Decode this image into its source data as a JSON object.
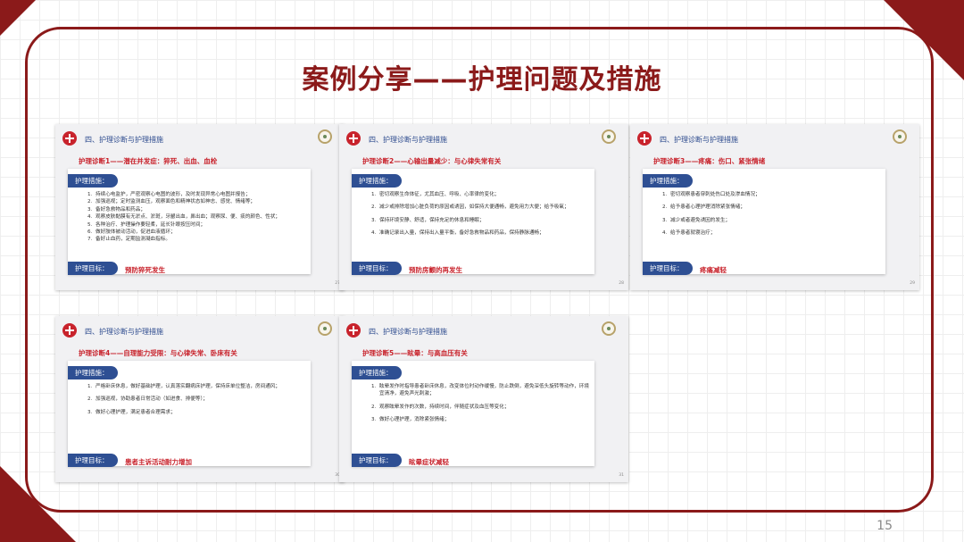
{
  "title": "案例分享——护理问题及措施",
  "page_number": "15",
  "slides": [
    {
      "section_title": "四、护理诊断与护理措施",
      "diagnosis": "护理诊断1——潜在并发症：猝死、出血、血栓",
      "measures_label": "护理措施：",
      "items": [
        "持续心电监护，严密观察心电图的波形，及时发现异常心电图并报告；",
        "加强巡视；定时监测血压，观察面色和精神状态如神志、感觉、情绪等；",
        "备好急救物品和药品；",
        "观察皮肤黏膜有无淤点、淤斑，牙龈出血，鼻出血；观察尿、便、痰的颜色、性状；",
        "各种治疗、护理操作要轻柔，延长针眼按压时间；",
        "做好肢体被动活动，促进血液循环；",
        "备好止血药，定期监测凝血指标。"
      ],
      "goal_label": "护理目标：",
      "goal_text": "预防猝死发生",
      "slide_number": "27"
    },
    {
      "section_title": "四、护理诊断与护理措施",
      "diagnosis": "护理诊断2——心输出量减少：与心律失常有关",
      "measures_label": "护理措施：",
      "items": [
        "密切观察生命体征，尤其血压、呼吸、心率律的变化；",
        "减少或排除增加心脏负荷的原因或诱因，如保持大便通畅，避免用力大便；给予吸氧；",
        "保持环境安静、舒适，保持充足的休息和睡眠；",
        "准确记录出入量，保持出入量平衡，备好急救物品和药品，保持静脉通畅；"
      ],
      "goal_label": "护理目标：",
      "goal_text": "预防房颤的再发生",
      "slide_number": "28"
    },
    {
      "section_title": "四、护理诊断与护理措施",
      "diagnosis": "护理诊断3——疼痛：伤口、紧张情绪",
      "measures_label": "护理措施：",
      "items": [
        "密切观察患者穿刺处伤口处及渗血情况；",
        "给予患者心理护理消除紧张情绪；",
        "减少或者避免诱因的发生；",
        "给予患者就寝治疗；"
      ],
      "goal_label": "护理目标：",
      "goal_text": "疼痛减轻",
      "slide_number": "29"
    },
    {
      "section_title": "四、护理诊断与护理措施",
      "diagnosis": "护理诊断4——自理能力受限：与心律失常、卧床有关",
      "measures_label": "护理措施：",
      "items": [
        "严格卧床休息，做好基础护理，认真落实翻病床护理，保持床单位整洁，房间通风；",
        "加强巡视，协助患者日常活动（如进食、排便等）；",
        "做好心理护理，满足患者合理需求；"
      ],
      "goal_label": "护理目标：",
      "goal_text": "患者主诉活动耐力增加",
      "slide_number": "30"
    },
    {
      "section_title": "四、护理诊断与护理措施",
      "diagnosis": "护理诊断5——眩晕：与高血压有关",
      "measures_label": "护理措施：",
      "items": [
        "眩晕发作时指导患者卧床休息，改变体位时动作缓慢，防止跌倒，避免深低头旋转等动作，环境宜清净，避免声光刺激；",
        "观察眩晕发作的次数，持续时间，伴随症状及血压等变化；",
        "做好心理护理，消除紧张情绪；"
      ],
      "goal_label": "护理目标：",
      "goal_text": "眩晕症状减轻",
      "slide_number": "31"
    }
  ]
}
